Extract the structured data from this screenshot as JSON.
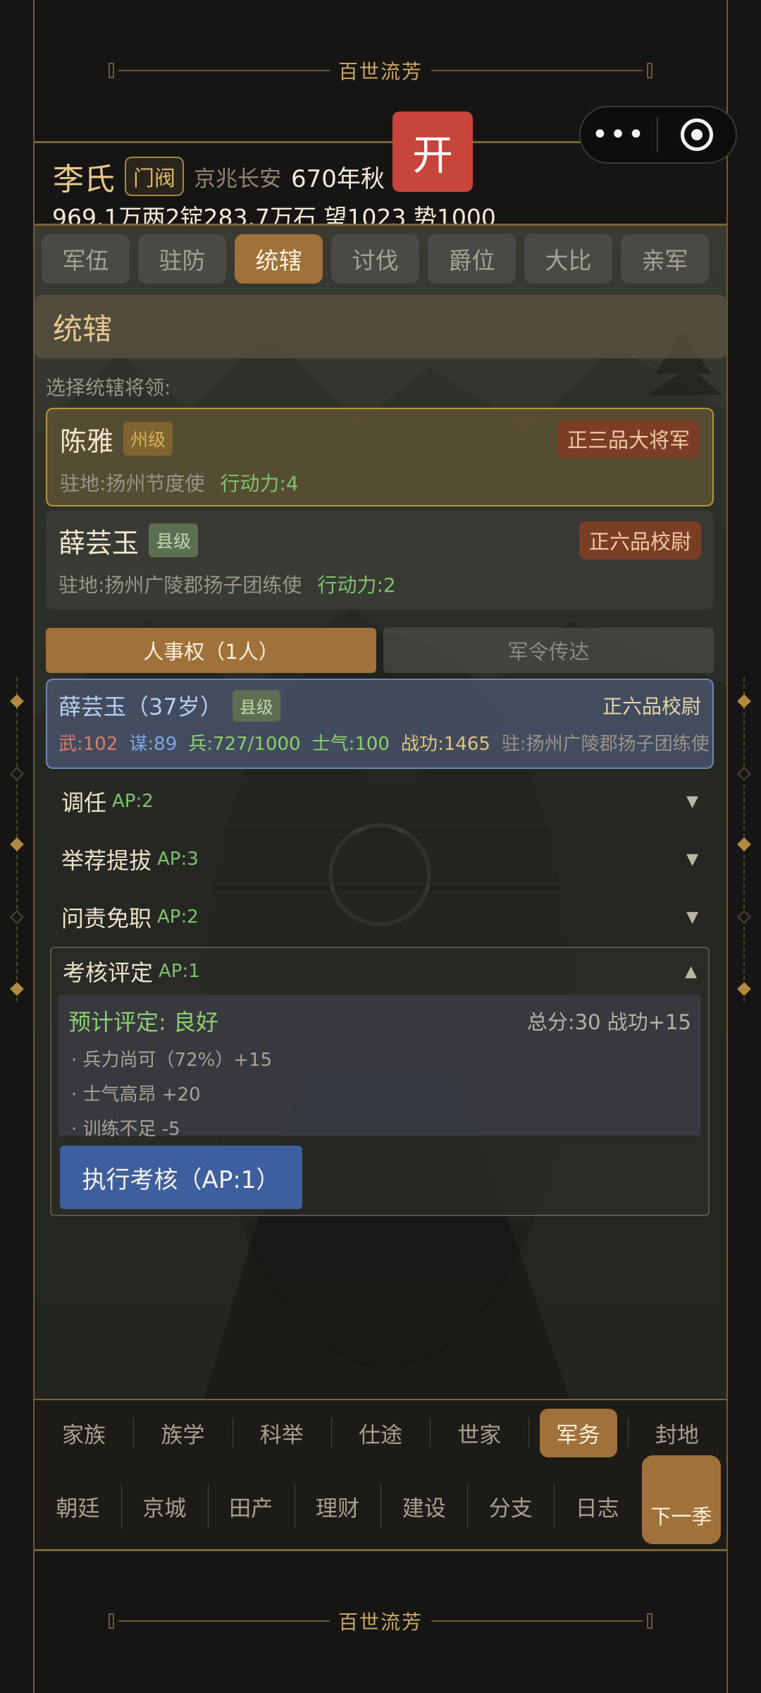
{
  "banner": {
    "title": "百世流芳"
  },
  "mini_program": {
    "more_icon": "more-dots-icon",
    "close_icon": "target-icon"
  },
  "open_button": {
    "label": "开"
  },
  "header": {
    "name": "李氏",
    "rank_tag": "门阀",
    "location": "京兆长安",
    "date": "670年秋",
    "stats": "969.1万两2锭283.7万石  望1023 势1000"
  },
  "tabs": [
    {
      "label": "军伍",
      "active": false
    },
    {
      "label": "驻防",
      "active": false
    },
    {
      "label": "统辖",
      "active": true
    },
    {
      "label": "讨伐",
      "active": false
    },
    {
      "label": "爵位",
      "active": false
    },
    {
      "label": "大比",
      "active": false
    },
    {
      "label": "亲军",
      "active": false
    }
  ],
  "section_title": "统辖",
  "select_label": "选择统辖将领:",
  "generals": [
    {
      "name": "陈雅",
      "level": "州级",
      "rank": "正三品大将军",
      "post": "驻地:扬州节度使",
      "action_points": "行动力:4",
      "selected": true
    },
    {
      "name": "薛芸玉",
      "level": "县级",
      "rank": "正六品校尉",
      "post": "驻地:扬州广陵郡扬子团练使",
      "action_points": "行动力:2",
      "selected": false
    }
  ],
  "subtabs": {
    "personnel": "人事权（1人）",
    "orders": "军令传达"
  },
  "officer": {
    "name": "薛芸玉（37岁）",
    "level": "县级",
    "rank": "正六品校尉",
    "wu": "武:102",
    "mou": "谋:89",
    "troops": "兵:727/1000",
    "morale": "士气:100",
    "merit": "战功:1465",
    "post": "驻:扬州广陵郡扬子团练使"
  },
  "actions": [
    {
      "title": "调任",
      "ap": "AP:2",
      "arrow": "▼"
    },
    {
      "title": "举荐提拔",
      "ap": "AP:3",
      "arrow": "▼"
    },
    {
      "title": "问责免职",
      "ap": "AP:2",
      "arrow": "▼"
    }
  ],
  "assessment": {
    "title": "考核评定",
    "ap": "AP:1",
    "arrow": "▲",
    "prediction": "预计评定: 良好",
    "score": "总分:30  战功+15",
    "items": [
      "· 兵力尚可（72%）+15",
      "· 士气高昂 +20",
      "· 训练不足 -5"
    ],
    "execute_label": "执行考核（AP:1）"
  },
  "nav_top": [
    {
      "label": "家族",
      "active": false
    },
    {
      "label": "族学",
      "active": false
    },
    {
      "label": "科举",
      "active": false
    },
    {
      "label": "仕途",
      "active": false
    },
    {
      "label": "世家",
      "active": false
    },
    {
      "label": "军务",
      "active": true
    },
    {
      "label": "封地",
      "active": false
    }
  ],
  "nav_bottom": [
    "朝廷",
    "京城",
    "田产",
    "理财",
    "建设",
    "分支",
    "日志"
  ],
  "next_season": "下一季",
  "colors": {
    "accent": "#a0713a",
    "gold": "#c9a664",
    "open_red": "#c8453b",
    "execute_blue": "#3e5f9e"
  }
}
